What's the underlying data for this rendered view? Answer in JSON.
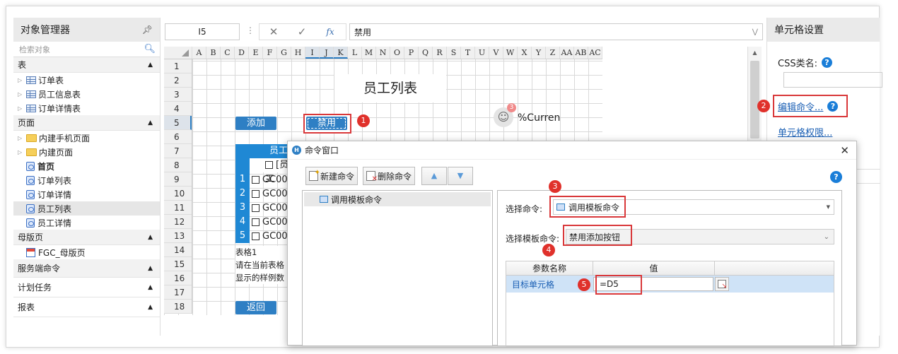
{
  "left_panel": {
    "title": "对象管理器",
    "search_placeholder": "检索对象",
    "sections": {
      "table": "表",
      "page": "页面",
      "master": "母版页",
      "server": "服务端命令",
      "schedule": "计划任务",
      "report": "报表"
    },
    "tables": [
      "订单表",
      "员工信息表",
      "订单详情表"
    ],
    "pages": {
      "folder1": "内建手机页面",
      "folder2": "内建页面",
      "items": [
        "首页",
        "订单列表",
        "订单详情",
        "员工列表",
        "员工详情"
      ]
    },
    "masters": [
      "FGC_母版页"
    ]
  },
  "formula_bar": {
    "cell_ref": "I5",
    "fx": "fx",
    "value": "禁用"
  },
  "sheet": {
    "columns": [
      "A",
      "B",
      "C",
      "D",
      "E",
      "F",
      "G",
      "H",
      "I",
      "J",
      "K",
      "L",
      "M",
      "N",
      "O",
      "P",
      "Q",
      "R",
      "S",
      "T",
      "U",
      "V",
      "W",
      "X",
      "Y",
      "Z",
      "AA",
      "AB",
      "AC"
    ],
    "rows": [
      "1",
      "2",
      "3",
      "4",
      "5",
      "6",
      "7",
      "8",
      "9",
      "10",
      "11",
      "12",
      "13",
      "14",
      "15",
      "16",
      "17",
      "18"
    ],
    "title": "员工列表",
    "add_button": "添加",
    "disable_button": "禁用",
    "back_button": "返回",
    "user_text": "%Curren",
    "user_badge": "3",
    "table_header": "员工",
    "table_sub": "[员工",
    "table_rows": [
      {
        "num": "1",
        "code": "GC00"
      },
      {
        "num": "2",
        "code": "GC00"
      },
      {
        "num": "3",
        "code": "GC00"
      },
      {
        "num": "4",
        "code": "GC00"
      },
      {
        "num": "5",
        "code": "GC00"
      }
    ],
    "note1": "表格1",
    "note2": "请在当前表格",
    "note3": "显示的样例数"
  },
  "right_panel": {
    "title": "单元格设置",
    "css_label": "CSS类名:",
    "edit_command": "编辑命令...",
    "cell_permission": "单元格权限..."
  },
  "dialog": {
    "title": "命令窗口",
    "new_command": "新建命令",
    "delete_command": "删除命令",
    "tree_item": "调用模板命令",
    "select_command_label": "选择命令:",
    "select_command_value": "调用模板命令",
    "select_template_label": "选择模板命令:",
    "select_template_value": "禁用添加按钮",
    "param_header_name": "参数名称",
    "param_header_value": "值",
    "param_name": "目标单元格",
    "param_value": "=D5"
  },
  "badges": [
    "1",
    "2",
    "3",
    "4",
    "5"
  ],
  "colors": {
    "accent_blue": "#2e7fc4",
    "badge_red": "#e0312b",
    "highlight_red": "#d9383a",
    "link_blue": "#1a5fb4"
  }
}
